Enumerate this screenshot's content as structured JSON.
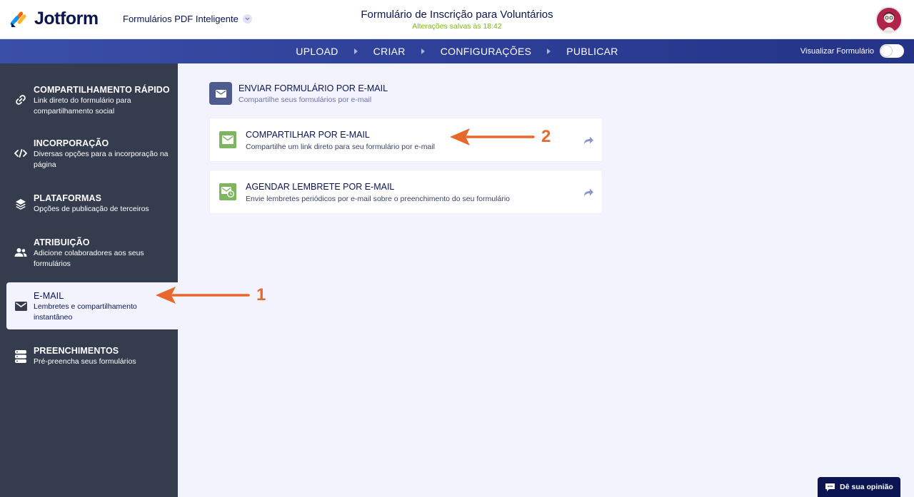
{
  "header": {
    "brand": "Jotform",
    "product_switch": "Formulários PDF Inteligente",
    "form_title": "Formulário de Inscrição para Voluntários",
    "saved_status": "Alterações salvas às 18:42",
    "avatar_icon": "user-avatar-icon"
  },
  "nav": {
    "steps": [
      "UPLOAD",
      "CRIAR",
      "CONFIGURAÇÕES",
      "PUBLICAR"
    ],
    "preview_label": "Visualizar Formulário",
    "preview_on": false
  },
  "sidebar": {
    "items": [
      {
        "title": "COMPARTILHAMENTO RÁPIDO",
        "desc": "Link direto do formulário para compartilhamento social",
        "icon": "link-icon"
      },
      {
        "title": "INCORPORAÇÃO",
        "desc": "Diversas opções para a incorporação na página",
        "icon": "code-icon"
      },
      {
        "title": "PLATAFORMAS",
        "desc": "Opções de publicação de terceiros",
        "icon": "layers-icon"
      },
      {
        "title": "ATRIBUIÇÃO",
        "desc": "Adicione colaboradores aos seus formulários",
        "icon": "users-icon"
      },
      {
        "title": "E-MAIL",
        "desc": "Lembretes e compartilhamento instantâneo",
        "icon": "envelope-icon",
        "active": true
      },
      {
        "title": "PREENCHIMENTOS",
        "desc": "Pré-preencha seus formulários",
        "icon": "database-icon"
      }
    ]
  },
  "main": {
    "section_title": "ENVIAR FORMULÁRIO POR E-MAIL",
    "section_sub": "Compartilhe seus formulários por e-mail",
    "cards": [
      {
        "title": "COMPARTILHAR POR E-MAIL",
        "desc": "Compartilhe um link direto para seu formulário por e-mail",
        "icon": "envelope-icon"
      },
      {
        "title": "AGENDAR LEMBRETE POR E-MAIL",
        "desc": "Envie lembretes periódicos por e-mail sobre o preenchimento do seu formulário",
        "icon": "envelope-clock-icon"
      }
    ]
  },
  "annotations": {
    "label_1": "1",
    "label_2": "2",
    "color": "#e8672a"
  },
  "feedback": {
    "label": "Dê sua opinião"
  },
  "colors": {
    "navy": "#0a1551",
    "sidebar_bg": "#343c4e",
    "nav_blue": "#2d3f97",
    "accent_green": "#78bb07",
    "card_icon_green": "#7fb560"
  }
}
